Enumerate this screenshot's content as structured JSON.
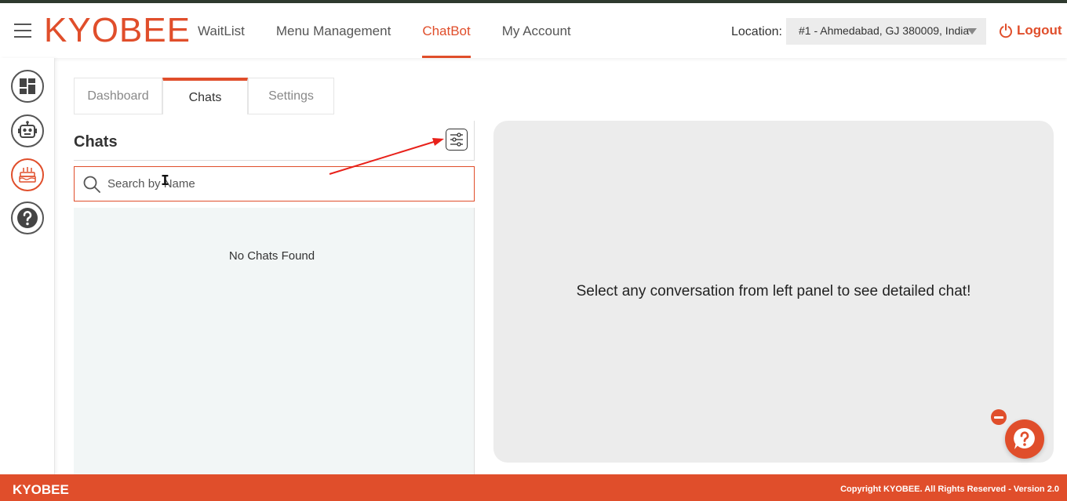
{
  "header": {
    "logo": "KYOBEE",
    "nav": [
      "WaitList",
      "Menu Management",
      "ChatBot",
      "My Account"
    ],
    "active_nav": "ChatBot",
    "location_label": "Location:",
    "location_value": "#1 - Ahmedabad, GJ 380009, India",
    "logout_label": "Logout"
  },
  "sidebar": {
    "items": [
      "dashboard-icon",
      "robot-icon",
      "cake-icon",
      "help-icon"
    ],
    "active": "cake-icon"
  },
  "tabs": {
    "items": [
      "Dashboard",
      "Chats",
      "Settings"
    ],
    "active": "Chats"
  },
  "chats": {
    "title": "Chats",
    "search_placeholder": "Search by Name",
    "empty_text": "No Chats Found"
  },
  "detail": {
    "message": "Select any conversation from left panel to see detailed chat!"
  },
  "footer": {
    "brand": "KYOBEE",
    "copyright": "Copyright KYOBEE. All Rights Reserved - Version 2.0"
  },
  "colors": {
    "accent": "#e04e2b",
    "panel_bg": "#ececec",
    "list_bg": "#f2f6f6"
  }
}
